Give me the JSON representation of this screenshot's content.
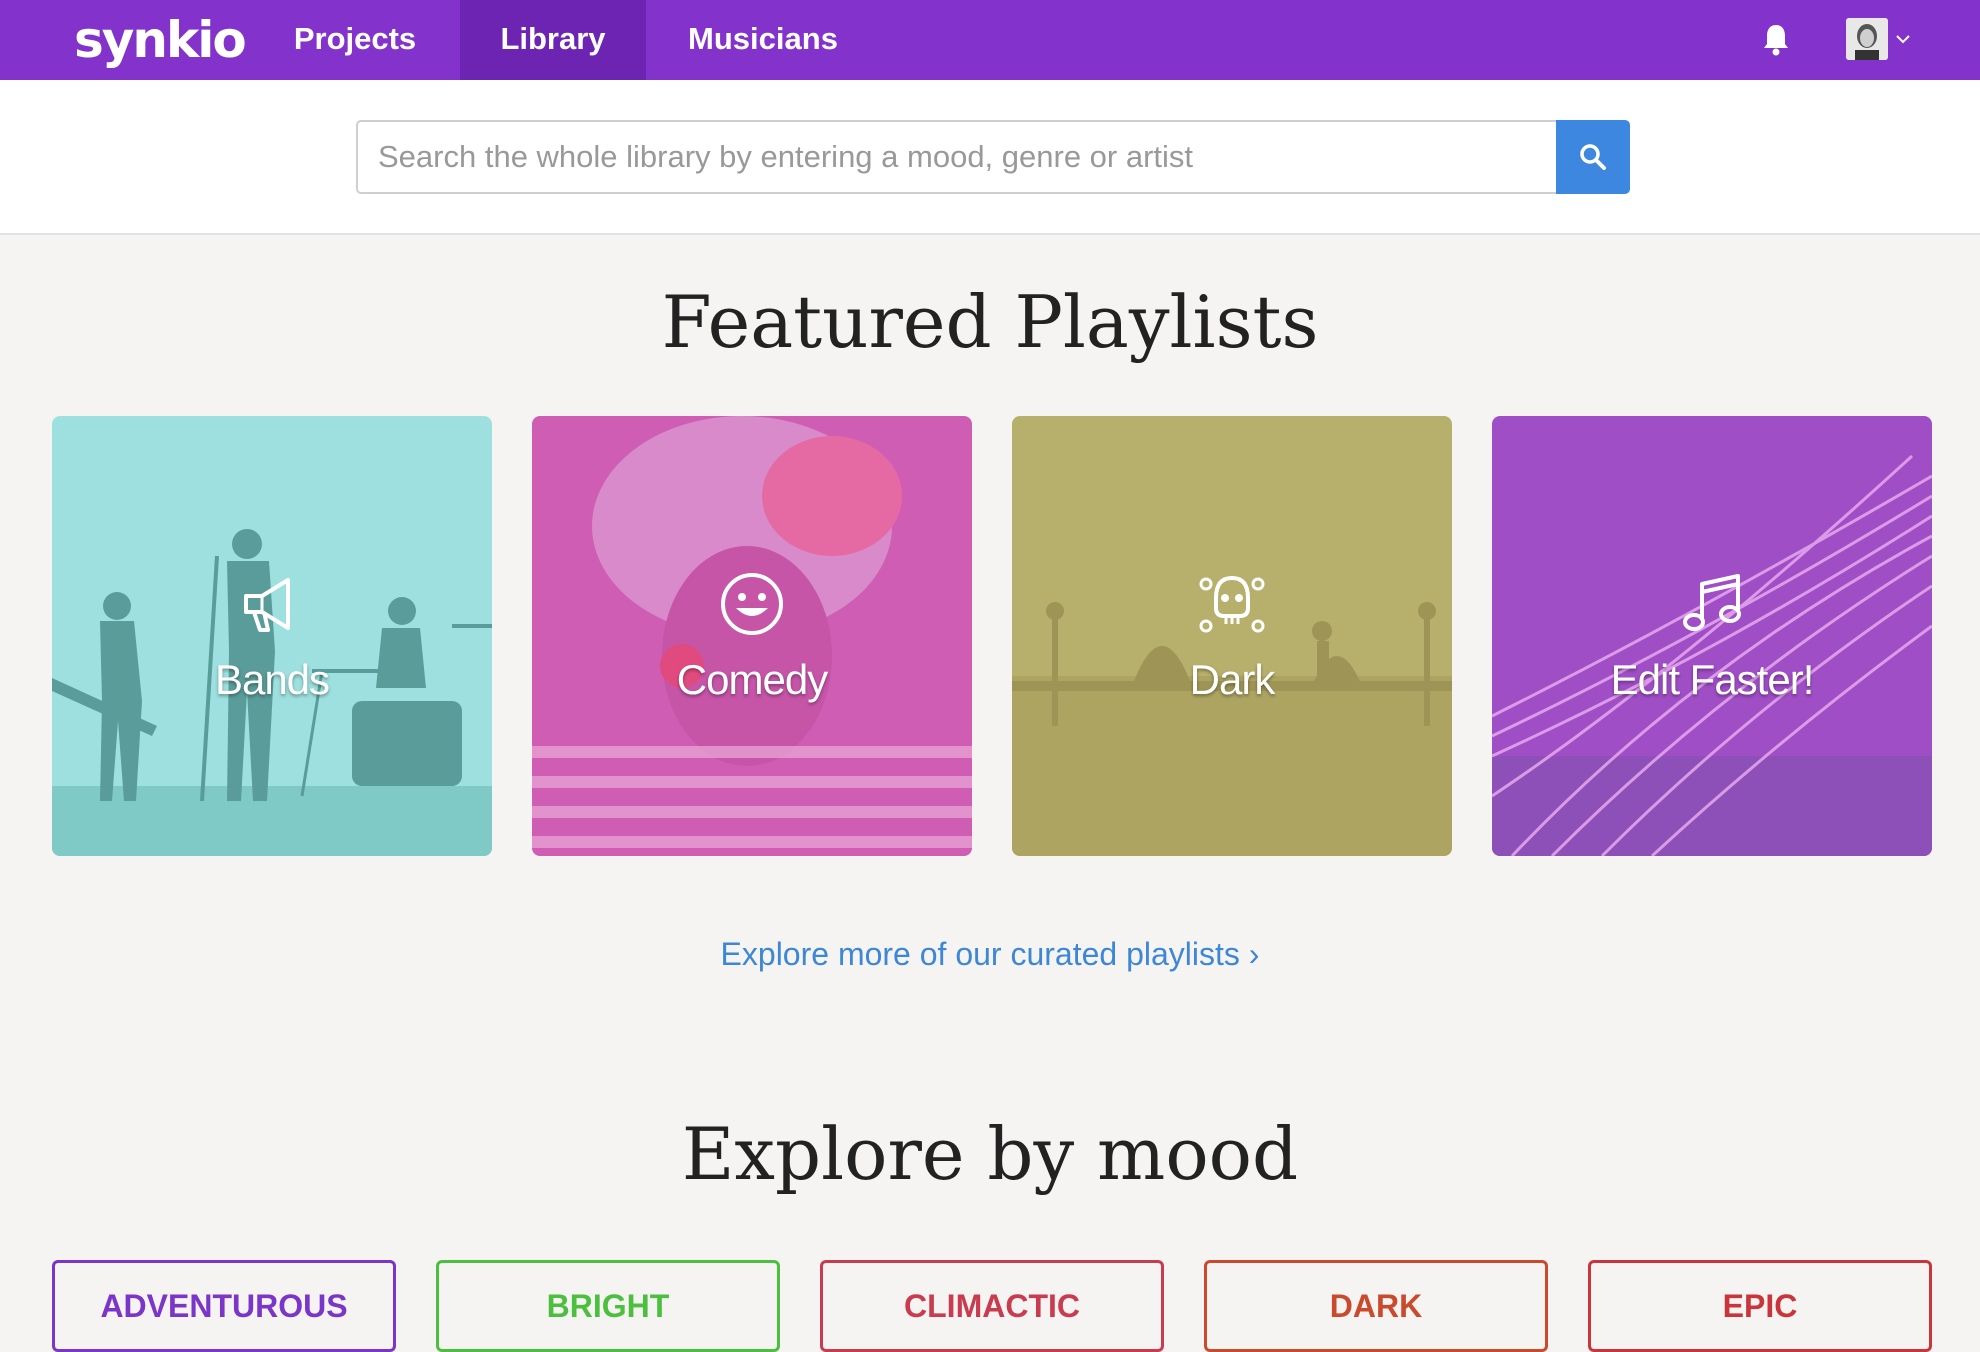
{
  "nav": {
    "logo": "synkio",
    "items": [
      {
        "label": "Projects",
        "active": false
      },
      {
        "label": "Library",
        "active": true
      },
      {
        "label": "Musicians",
        "active": false
      }
    ],
    "icons": {
      "bell": "bell-icon",
      "avatar": "user-avatar",
      "caret": "chevron-down-icon"
    }
  },
  "search": {
    "placeholder": "Search the whole library by entering a mood, genre or artist",
    "value": "",
    "button_icon": "search-icon"
  },
  "featured": {
    "title": "Featured Playlists",
    "playlists": [
      {
        "label": "Bands",
        "icon": "megaphone-icon",
        "color": "#9de0df"
      },
      {
        "label": "Comedy",
        "icon": "smiley-icon",
        "color": "#d05fb4"
      },
      {
        "label": "Dark",
        "icon": "skull-crossbones-icon",
        "color": "#b4ae6a"
      },
      {
        "label": "Edit Faster!",
        "icon": "music-note-icon",
        "color": "#a351c4"
      }
    ],
    "explore_link": "Explore more of our curated playlists ›"
  },
  "moods": {
    "title": "Explore by mood",
    "items": [
      {
        "label": "ADVENTUROUS",
        "color": "#7b35c8"
      },
      {
        "label": "BRIGHT",
        "color": "#4dbf3f"
      },
      {
        "label": "CLIMACTIC",
        "color": "#c93b4f"
      },
      {
        "label": "DARK",
        "color": "#c94a2c"
      },
      {
        "label": "EPIC",
        "color": "#c9353b"
      }
    ]
  },
  "colors": {
    "nav": "#8332cc",
    "nav_active": "#6d24b2",
    "accent": "#3d87e0"
  }
}
